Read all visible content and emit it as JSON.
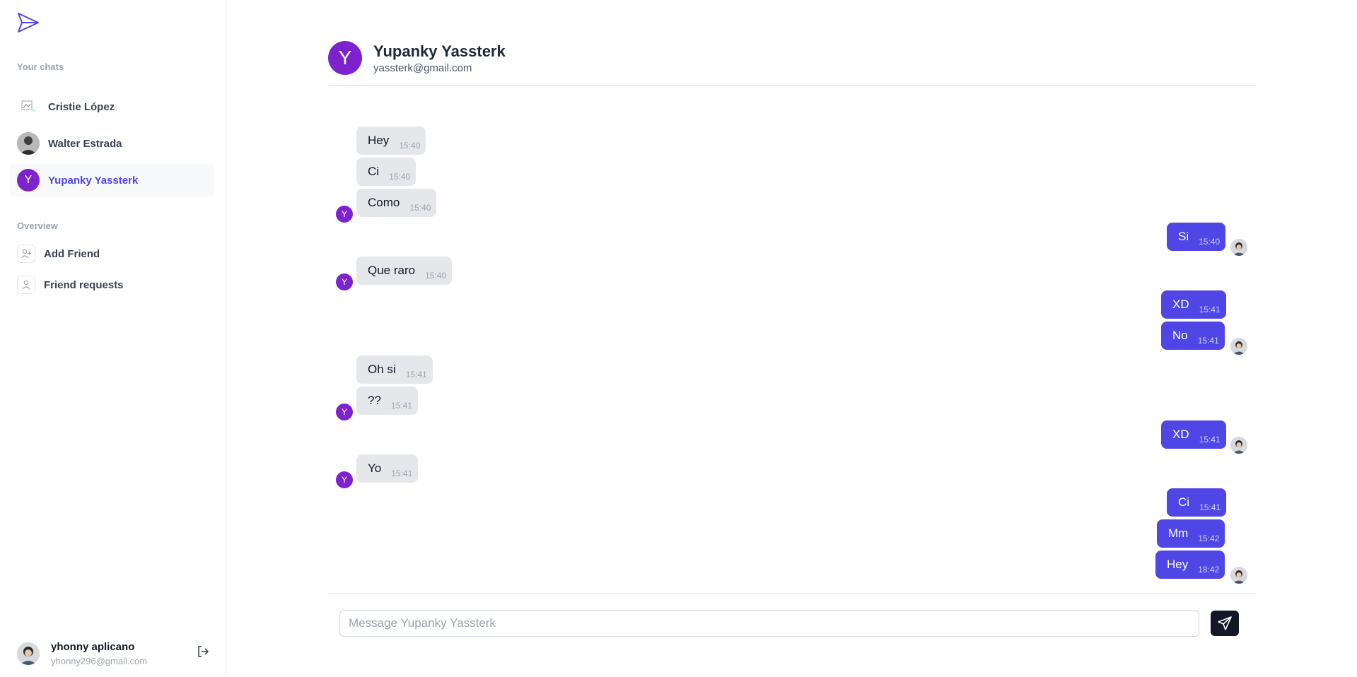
{
  "sidebar": {
    "your_chats_label": "Your chats",
    "chats": [
      {
        "name": "Cristie López",
        "avatar": "broken-image"
      },
      {
        "name": "Walter Estrada",
        "avatar": "photo"
      },
      {
        "name": "Yupanky Yassterk",
        "avatar_letter": "Y"
      }
    ],
    "overview_label": "Overview",
    "overview": [
      {
        "label": "Add Friend",
        "icon": "user-plus-icon"
      },
      {
        "label": "Friend requests",
        "icon": "user-icon"
      }
    ],
    "me": {
      "name": "yhonny aplicano",
      "email": "yhonny296@gmail.com"
    }
  },
  "header": {
    "avatar_letter": "Y",
    "name": "Yupanky Yassterk",
    "email": "yassterk@gmail.com"
  },
  "messages": [
    {
      "dir": "in",
      "text": "Hey",
      "time": "15:40"
    },
    {
      "dir": "in",
      "text": "Ci",
      "time": "15:40"
    },
    {
      "dir": "in",
      "text": "Como",
      "time": "15:40"
    },
    {
      "dir": "out",
      "text": "Si",
      "time": "15:40"
    },
    {
      "dir": "in",
      "text": "Que raro",
      "time": "15:40"
    },
    {
      "dir": "out",
      "text": "XD",
      "time": "15:41"
    },
    {
      "dir": "out",
      "text": "No",
      "time": "15:41"
    },
    {
      "dir": "in",
      "text": "Oh si",
      "time": "15:41"
    },
    {
      "dir": "in",
      "text": "??",
      "time": "15:41"
    },
    {
      "dir": "out",
      "text": "XD",
      "time": "15:41"
    },
    {
      "dir": "in",
      "text": "Yo",
      "time": "15:41"
    },
    {
      "dir": "out",
      "text": "Ci",
      "time": "15:41"
    },
    {
      "dir": "out",
      "text": "Mm",
      "time": "15:42"
    },
    {
      "dir": "out",
      "text": "Hey",
      "time": "18:42"
    }
  ],
  "composer": {
    "placeholder": "Message Yupanky Yassterk"
  },
  "colors": {
    "accent": "#4f46e5",
    "avatar_purple": "#7e22ce",
    "incoming_bubble": "#e5e7eb"
  }
}
